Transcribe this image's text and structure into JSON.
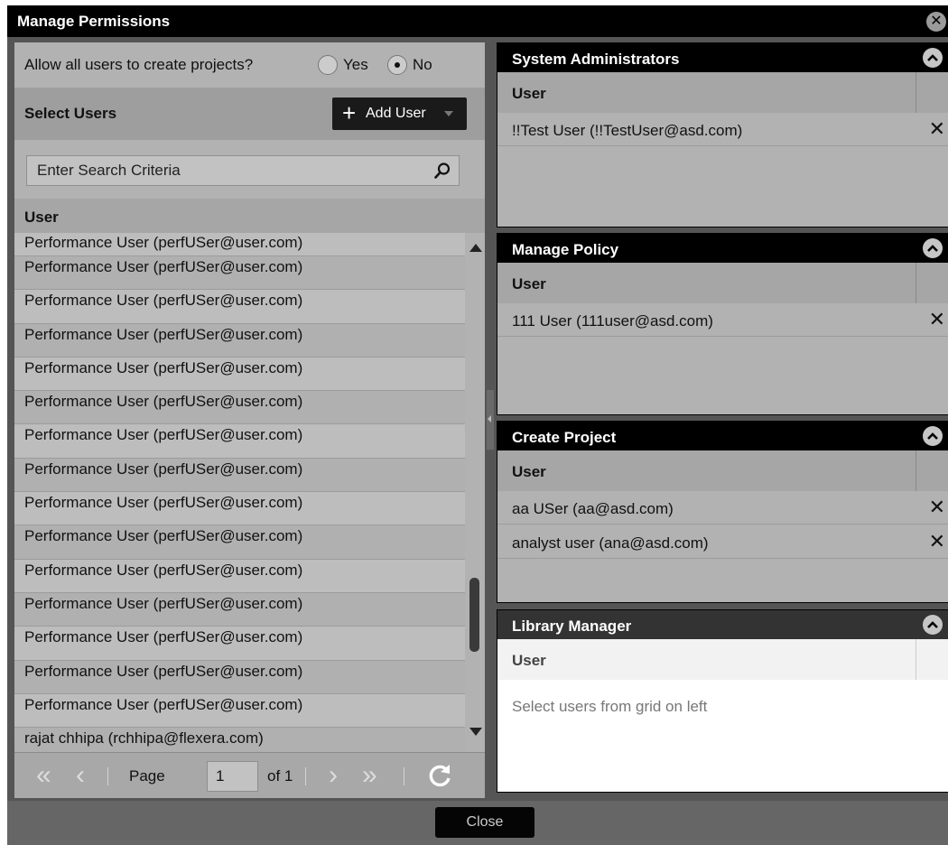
{
  "dialog": {
    "title": "Manage Permissions",
    "close_glyph": "✕"
  },
  "allow": {
    "question": "Allow all users to create projects?",
    "yes_label": "Yes",
    "no_label": "No",
    "selected": "No"
  },
  "select_users": {
    "title": "Select Users",
    "add_user_label": "Add User",
    "search_placeholder": "Enter Search Criteria",
    "column_header": "User",
    "rows": [
      "Performance User (perfUSer@user.com)",
      "Performance User (perfUSer@user.com)",
      "Performance User (perfUSer@user.com)",
      "Performance User (perfUSer@user.com)",
      "Performance User (perfUSer@user.com)",
      "Performance User (perfUSer@user.com)",
      "Performance User (perfUSer@user.com)",
      "Performance User (perfUSer@user.com)",
      "Performance User (perfUSer@user.com)",
      "Performance User (perfUSer@user.com)",
      "Performance User (perfUSer@user.com)",
      "Performance User (perfUSer@user.com)",
      "Performance User (perfUSer@user.com)",
      "Performance User (perfUSer@user.com)",
      "Performance User (perfUSer@user.com)",
      "rajat chhipa (rchhipa@flexera.com)"
    ]
  },
  "pager": {
    "page_label": "Page",
    "page_value": "1",
    "of_label": "of 1"
  },
  "panels": {
    "sysadmin": {
      "title": "System Administrators",
      "column_header": "User",
      "rows": [
        "!!Test User (!!TestUser@asd.com)"
      ]
    },
    "policy": {
      "title": "Manage Policy",
      "column_header": "User",
      "rows": [
        "111 User (111user@asd.com)"
      ]
    },
    "create": {
      "title": "Create Project",
      "column_header": "User",
      "rows": [
        "aa USer (aa@asd.com)",
        "analyst user (ana@asd.com)"
      ]
    },
    "library": {
      "title": "Library Manager",
      "column_header": "User",
      "empty_text": "Select users from grid on left"
    }
  },
  "remove_glyph": "✕",
  "footer": {
    "close_label": "Close"
  }
}
